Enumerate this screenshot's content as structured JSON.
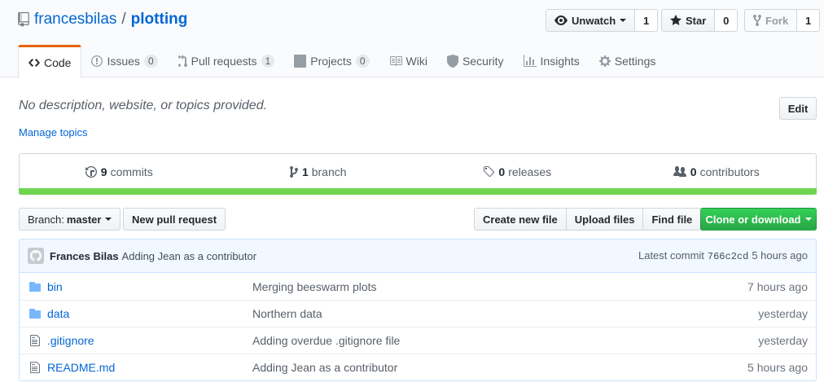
{
  "repo": {
    "owner": "francesbilas",
    "separator": "/",
    "name": "plotting"
  },
  "actions": {
    "watch": {
      "label": "Unwatch",
      "count": "1"
    },
    "star": {
      "label": "Star",
      "count": "0"
    },
    "fork": {
      "label": "Fork",
      "count": "1"
    }
  },
  "tabs": [
    {
      "label": "Code",
      "counter": ""
    },
    {
      "label": "Issues",
      "counter": "0"
    },
    {
      "label": "Pull requests",
      "counter": "1"
    },
    {
      "label": "Projects",
      "counter": "0"
    },
    {
      "label": "Wiki",
      "counter": ""
    },
    {
      "label": "Security",
      "counter": ""
    },
    {
      "label": "Insights",
      "counter": ""
    },
    {
      "label": "Settings",
      "counter": ""
    }
  ],
  "description": "No description, website, or topics provided.",
  "manage_topics": "Manage topics",
  "edit_label": "Edit",
  "summary": {
    "commits": {
      "count": "9",
      "label": "commits"
    },
    "branches": {
      "count": "1",
      "label": "branch"
    },
    "releases": {
      "count": "0",
      "label": "releases"
    },
    "contributors": {
      "count": "0",
      "label": "contributors"
    }
  },
  "language_color": "#6fd550",
  "file_nav": {
    "branch_label": "Branch:",
    "branch_value": "master",
    "new_pr": "New pull request",
    "create_file": "Create new file",
    "upload_files": "Upload files",
    "find_file": "Find file",
    "clone": "Clone or download"
  },
  "latest_commit": {
    "author": "Frances Bilas",
    "message": "Adding Jean as a contributor",
    "prefix": "Latest commit",
    "sha": "766c2cd",
    "age": "5 hours ago"
  },
  "files": [
    {
      "type": "folder",
      "name": "bin",
      "message": "Merging beeswarm plots",
      "age": "7 hours ago"
    },
    {
      "type": "folder",
      "name": "data",
      "message": "Northern data",
      "age": "yesterday"
    },
    {
      "type": "file",
      "name": ".gitignore",
      "message": "Adding overdue .gitignore file",
      "age": "yesterday"
    },
    {
      "type": "file",
      "name": "README.md",
      "message": "Adding Jean as a contributor",
      "age": "5 hours ago"
    }
  ]
}
